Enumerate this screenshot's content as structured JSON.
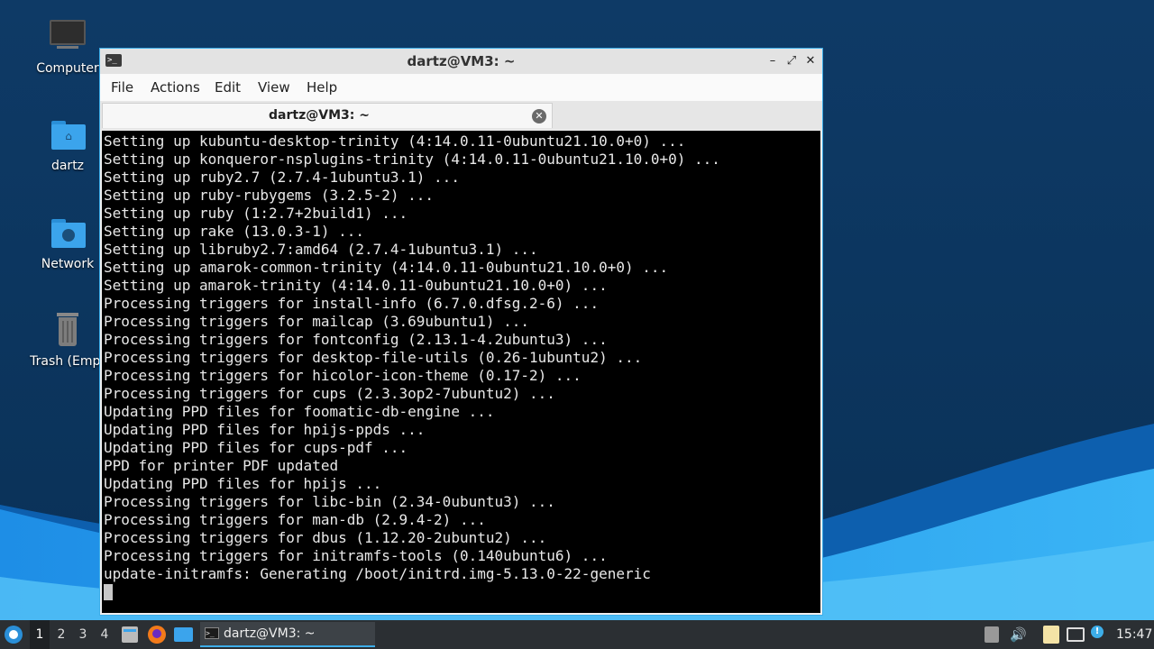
{
  "desktop": {
    "icons": [
      {
        "label": "Computer"
      },
      {
        "label": "dartz"
      },
      {
        "label": "Network"
      },
      {
        "label": "Trash (Empt"
      }
    ]
  },
  "window": {
    "title": "dartz@VM3: ~",
    "menu": [
      "File",
      "Actions",
      "Edit",
      "View",
      "Help"
    ],
    "tab_label": "dartz@VM3: ~",
    "terminal_lines": [
      "Setting up kubuntu-desktop-trinity (4:14.0.11-0ubuntu21.10.0+0) ...",
      "Setting up konqueror-nsplugins-trinity (4:14.0.11-0ubuntu21.10.0+0) ...",
      "Setting up ruby2.7 (2.7.4-1ubuntu3.1) ...",
      "Setting up ruby-rubygems (3.2.5-2) ...",
      "Setting up ruby (1:2.7+2build1) ...",
      "Setting up rake (13.0.3-1) ...",
      "Setting up libruby2.7:amd64 (2.7.4-1ubuntu3.1) ...",
      "Setting up amarok-common-trinity (4:14.0.11-0ubuntu21.10.0+0) ...",
      "Setting up amarok-trinity (4:14.0.11-0ubuntu21.10.0+0) ...",
      "Processing triggers for install-info (6.7.0.dfsg.2-6) ...",
      "Processing triggers for mailcap (3.69ubuntu1) ...",
      "Processing triggers for fontconfig (2.13.1-4.2ubuntu3) ...",
      "Processing triggers for desktop-file-utils (0.26-1ubuntu2) ...",
      "Processing triggers for hicolor-icon-theme (0.17-2) ...",
      "Processing triggers for cups (2.3.3op2-7ubuntu2) ...",
      "Updating PPD files for foomatic-db-engine ...",
      "Updating PPD files for hpijs-ppds ...",
      "Updating PPD files for cups-pdf ...",
      "PPD for printer PDF updated",
      "Updating PPD files for hpijs ...",
      "Processing triggers for libc-bin (2.34-0ubuntu3) ...",
      "Processing triggers for man-db (2.9.4-2) ...",
      "Processing triggers for dbus (1.12.20-2ubuntu2) ...",
      "Processing triggers for initramfs-tools (0.140ubuntu6) ...",
      "update-initramfs: Generating /boot/initrd.img-5.13.0-22-generic"
    ]
  },
  "taskbar": {
    "workspaces": [
      "1",
      "2",
      "3",
      "4"
    ],
    "active_workspace": "1",
    "window_button_label": "dartz@VM3: ~",
    "clock": "15:47"
  },
  "colors": {
    "accent": "#3daee9",
    "terminal_bg": "#000000",
    "terminal_fg": "#e8e8e8"
  }
}
